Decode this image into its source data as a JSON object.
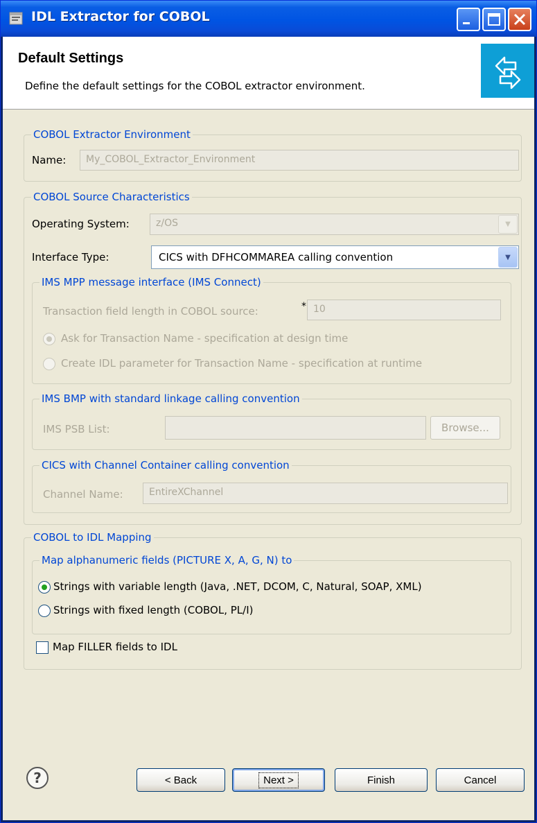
{
  "window": {
    "title": "IDL Extractor for COBOL"
  },
  "header": {
    "title": "Default Settings",
    "description": "Define the default settings for the COBOL extractor environment."
  },
  "env_group": {
    "legend": "COBOL Extractor Environment",
    "name_label": "Name:",
    "name_value": "My_COBOL_Extractor_Environment"
  },
  "source_group": {
    "legend": "COBOL Source Characteristics",
    "os_label": "Operating System:",
    "os_value": "z/OS",
    "interface_label": "Interface Type:",
    "interface_value": "CICS with DFHCOMMAREA calling convention",
    "ims_mpp": {
      "legend": "IMS MPP message interface (IMS Connect)",
      "tx_length_label": "Transaction field length in COBOL source:",
      "required_mark": "*",
      "tx_length_value": "10",
      "radio_ask": "Ask for Transaction Name - specification at design time",
      "radio_create": "Create IDL parameter for Transaction Name - specification at runtime"
    },
    "ims_bmp": {
      "legend": "IMS BMP with standard linkage calling convention",
      "psb_label": "IMS PSB List:",
      "psb_value": "",
      "browse_label": "Browse..."
    },
    "cics_channel": {
      "legend": "CICS with Channel Container calling convention",
      "channel_label": "Channel Name:",
      "channel_value": "EntireXChannel"
    }
  },
  "mapping_group": {
    "legend": "COBOL to IDL Mapping",
    "alpha_group": {
      "legend": "Map alphanumeric fields (PICTURE X, A, G, N) to",
      "radio_variable": "Strings with variable length (Java, .NET, DCOM, C, Natural, SOAP, XML)",
      "radio_fixed": "Strings with fixed length (COBOL, PL/I)",
      "selected": "variable"
    },
    "filler_label": "Map FILLER fields to IDL",
    "filler_checked": false
  },
  "footer": {
    "help_glyph": "?",
    "back_label": "< Back",
    "next_label": "Next >",
    "finish_label": "Finish",
    "cancel_label": "Cancel"
  },
  "icons": [
    "application-icon",
    "minimize-icon",
    "maximize-icon",
    "close-icon",
    "wizard-banner-arrows-icon",
    "help-icon"
  ],
  "colors": {
    "titlebar": "#0054e3",
    "dialog_bg": "#ece9d8",
    "group_legend": "#0046d5",
    "banner": "#0e9fd6"
  }
}
